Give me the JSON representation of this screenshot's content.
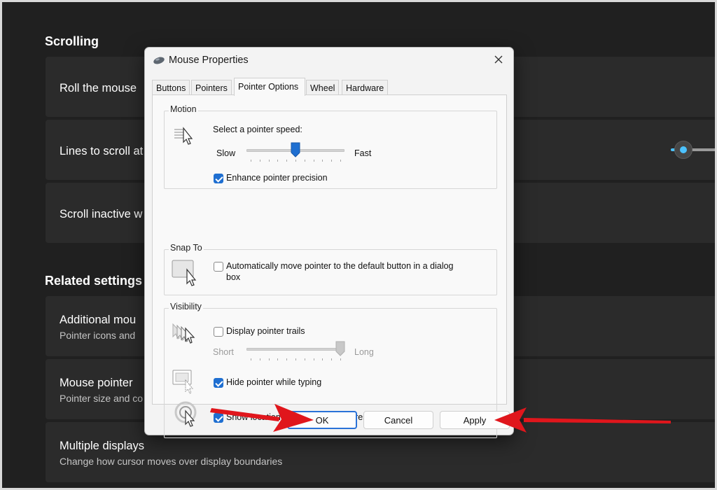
{
  "settings": {
    "scrolling_heading": "Scrolling",
    "roll_mouse_label": "Roll the mouse",
    "lines_to_scroll_label": "Lines to scroll at",
    "scroll_inactive_label": "Scroll inactive w",
    "related_heading": "Related settings",
    "additional_mouse_title": "Additional mou",
    "additional_mouse_sub": "Pointer icons and",
    "mouse_pointer_title": "Mouse pointer",
    "mouse_pointer_sub": "Pointer size and co",
    "multiple_displays_title": "Multiple displays",
    "multiple_displays_sub": "Change how cursor moves over display boundaries"
  },
  "dialog": {
    "title": "Mouse Properties",
    "tabs": [
      {
        "label": "Buttons"
      },
      {
        "label": "Pointers"
      },
      {
        "label": "Pointer Options"
      },
      {
        "label": "Wheel"
      },
      {
        "label": "Hardware"
      }
    ],
    "motion": {
      "group_label": "Motion",
      "speed_label": "Select a pointer speed:",
      "slow_label": "Slow",
      "fast_label": "Fast",
      "speed_value": 0.5,
      "enhance_label": "Enhance pointer precision",
      "enhance_checked": true
    },
    "snap_to": {
      "group_label": "Snap To",
      "auto_move_label_line1": "Automatically move pointer to the default button in a dialog",
      "auto_move_label_line2": "box",
      "auto_move_checked": false
    },
    "visibility": {
      "group_label": "Visibility",
      "trails_label": "Display pointer trails",
      "trails_checked": false,
      "short_label": "Short",
      "long_label": "Long",
      "trails_length_value": 1.0,
      "hide_label": "Hide pointer while typing",
      "hide_checked": true,
      "show_location_label": "Show location of pointer when I press the CTRL key",
      "show_location_checked": true
    },
    "buttons": {
      "ok": "OK",
      "cancel": "Cancel",
      "apply": "Apply"
    }
  },
  "colors": {
    "accent": "#1f6fd1",
    "annotation_arrow": "#e0161c",
    "settings_background": "#202020"
  }
}
